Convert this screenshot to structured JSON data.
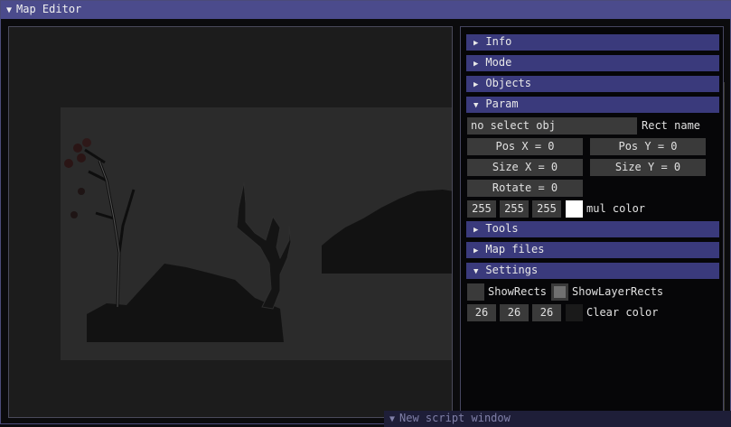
{
  "window": {
    "title": "Map Editor"
  },
  "panel": {
    "sections": {
      "info": "Info",
      "mode": "Mode",
      "objects": "Objects",
      "param": "Param",
      "tools": "Tools",
      "map_files": "Map files",
      "settings": "Settings"
    },
    "param": {
      "selected_obj": "no select obj",
      "rect_name_label": "Rect name",
      "pos_x": "Pos X = 0",
      "pos_y": "Pos Y = 0",
      "size_x": "Size X = 0",
      "size_y": "Size Y = 0",
      "rotate": "Rotate = 0",
      "mul_r": "255",
      "mul_g": "255",
      "mul_b": "255",
      "mul_color_label": "mul color",
      "mul_color_swatch": "#ffffff"
    },
    "settings": {
      "show_rects_label": "ShowRects",
      "show_rects_checked": false,
      "show_layer_rects_label": "ShowLayerRects",
      "show_layer_rects_checked": true,
      "clear_r": "26",
      "clear_g": "26",
      "clear_b": "26",
      "clear_color_label": "Clear color",
      "clear_color_swatch": "#1a1a1a"
    }
  },
  "background": {
    "bottom_window_title": "New script window"
  },
  "colors": {
    "title_bar": "#4b4b8c",
    "section_header": "#3a3a7c",
    "input_bg": "#3a3a3a"
  }
}
